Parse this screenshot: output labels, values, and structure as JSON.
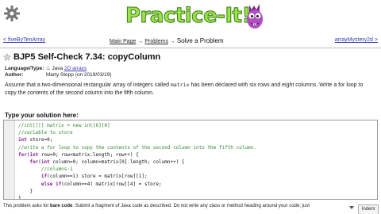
{
  "header": {
    "logo_text": "Practice-It!",
    "colors": {
      "logo_fill": "#9be34a",
      "logo_outline": "#3a7a14",
      "mascot": "#b04fc0"
    }
  },
  "nav": {
    "prev": "< fiveByTenArray",
    "main_page": "Main Page",
    "arrow1": "→",
    "problems": "Problems",
    "arrow2": "→",
    "current": "Solve a Problem",
    "next": "arrayMystery2d >"
  },
  "problem": {
    "title": "BJP5 Self-Check 7.34: copyColumn",
    "language_label": "Language/Type:",
    "language_value": "Java",
    "language_topic": "2D arrays",
    "author_label": "Author:",
    "author_value": "Marty Stepp (on 2019/03/19)",
    "desc_before": "Assume that a two-dimensional rectangular array of integers called ",
    "desc_code": "matrix",
    "desc_after": " has been declared with six rows and eight columns. Write a for loop to copy the contents of the second column into the fifth column."
  },
  "solution": {
    "label": "Type your solution here:",
    "lines": [
      [
        {
          "t": "//int[][] matrix = new int[6][8]",
          "k": "c-com"
        }
      ],
      [
        {
          "t": "//variable to store",
          "k": "c-com"
        }
      ],
      [
        {
          "t": "int",
          "k": "c-kw"
        },
        {
          "t": " store=0;",
          "k": "c-tx"
        }
      ],
      [
        {
          "t": "//write a for loop to copy the contents of the second column into the fifth column.",
          "k": "c-com"
        }
      ],
      [
        {
          "t": "for",
          "k": "c-kw"
        },
        {
          "t": "(",
          "k": "c-tx"
        },
        {
          "t": "int",
          "k": "c-kw"
        },
        {
          "t": " row=0; row<matrix.length; row++) {",
          "k": "c-tx"
        }
      ],
      [
        {
          "t": "    ",
          "k": "c-tx"
        },
        {
          "t": "for",
          "k": "c-kw"
        },
        {
          "t": "(",
          "k": "c-tx"
        },
        {
          "t": "int",
          "k": "c-kw"
        },
        {
          "t": " column=0; column<matrix[0].length; column++) {",
          "k": "c-tx"
        }
      ],
      [
        {
          "t": "        //columns-1",
          "k": "c-com"
        }
      ],
      [
        {
          "t": "        ",
          "k": "c-tx"
        },
        {
          "t": "if",
          "k": "c-kw"
        },
        {
          "t": "(column==1) store = matrix[row][1];",
          "k": "c-tx"
        }
      ],
      [
        {
          "t": "        ",
          "k": "c-tx"
        },
        {
          "t": "else if",
          "k": "c-kw"
        },
        {
          "t": "(column==4) matrix[row][4] = store;",
          "k": "c-tx"
        }
      ],
      [
        {
          "t": "    }",
          "k": "c-tx"
        }
      ],
      [
        {
          "t": "}",
          "k": "c-tx"
        }
      ]
    ]
  },
  "footer": {
    "before": "This problem asks for ",
    "bare_code": "bare code",
    "after": ". Submit a fragment of Java code as described. Do not write any class or method heading around your code; just",
    "indent_label": "Indent"
  }
}
